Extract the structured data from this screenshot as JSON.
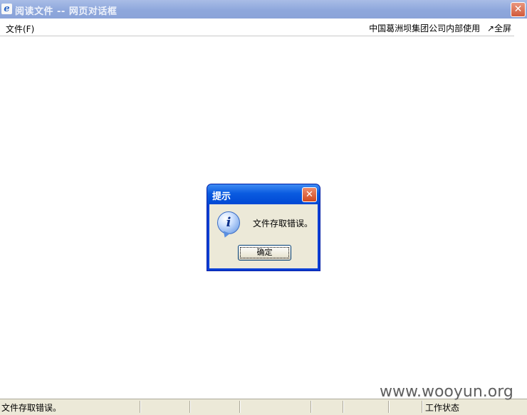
{
  "window": {
    "title": "阅读文件 -- 网页对话框",
    "close_glyph": "✕",
    "icon": "ie-icon"
  },
  "menubar": {
    "file_menu": "文件(F)",
    "notice": "中国葛洲坝集团公司内部使用",
    "fullscreen": "↗全屏"
  },
  "dialog": {
    "title": "提示",
    "close_glyph": "✕",
    "icon": "info-icon",
    "message": "文件存取错误。",
    "ok_label": "确定"
  },
  "statusbar": {
    "text": "文件存取错误。",
    "work_status": "工作状态"
  },
  "watermark": "www.wooyun.org",
  "colors": {
    "dialog_title": "#0a5be0",
    "window_title": "#8ea7dc",
    "dialog_body": "#ece9d8"
  }
}
